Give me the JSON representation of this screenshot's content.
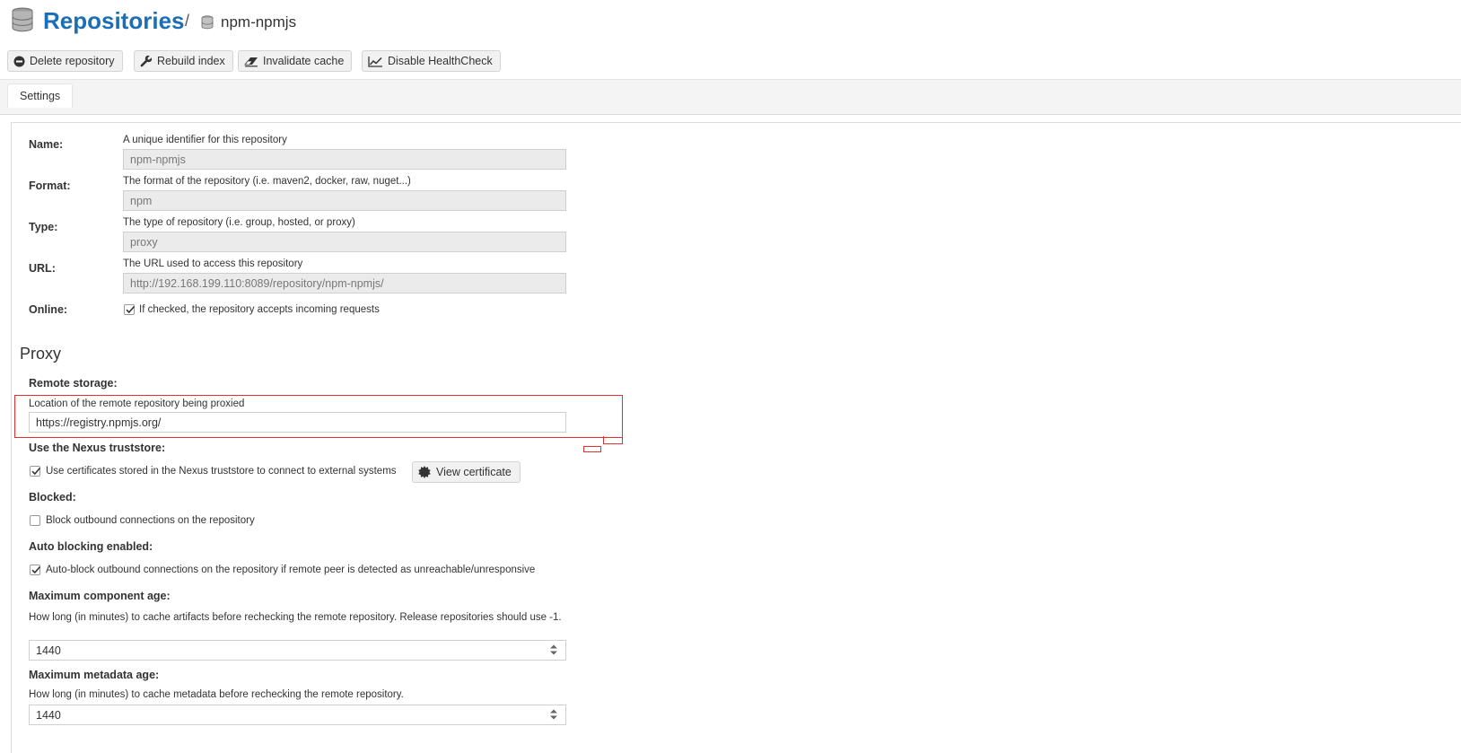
{
  "header": {
    "title": "Repositories",
    "separator": "/",
    "subtitle": "npm-npmjs"
  },
  "toolbar": {
    "delete_label": "Delete repository",
    "rebuild_label": "Rebuild index",
    "invalidate_label": "Invalidate cache",
    "healthcheck_label": "Disable HealthCheck"
  },
  "tabs": {
    "settings": "Settings"
  },
  "form": {
    "name": {
      "label": "Name:",
      "help": "A unique identifier for this repository",
      "value": "npm-npmjs"
    },
    "format": {
      "label": "Format:",
      "help": "The format of the repository (i.e. maven2, docker, raw, nuget...)",
      "value": "npm"
    },
    "type": {
      "label": "Type:",
      "help": "The type of repository (i.e. group, hosted, or proxy)",
      "value": "proxy"
    },
    "url": {
      "label": "URL:",
      "help": "The URL used to access this repository",
      "value": "http://192.168.199.110:8089/repository/npm-npmjs/"
    },
    "online": {
      "label": "Online:",
      "help": "If checked, the repository accepts incoming requests",
      "checked": true
    }
  },
  "proxy": {
    "section_title": "Proxy",
    "remote_storage": {
      "label": "Remote storage:",
      "help": "Location of the remote repository being proxied",
      "value": "https://registry.npmjs.org/"
    },
    "truststore": {
      "label": "Use the Nexus truststore:",
      "help": "Use certificates stored in the Nexus truststore to connect to external systems",
      "checked": true,
      "button": "View certificate"
    },
    "blocked": {
      "label": "Blocked:",
      "help": "Block outbound connections on the repository",
      "checked": false
    },
    "auto_blocking": {
      "label": "Auto blocking enabled:",
      "help": "Auto-block outbound connections on the repository if remote peer is detected as unreachable/unresponsive",
      "checked": true
    },
    "max_component_age": {
      "label": "Maximum component age:",
      "help": "How long (in minutes) to cache artifacts before rechecking the remote repository. Release repositories should use -1.",
      "value": "1440"
    },
    "max_metadata_age": {
      "label": "Maximum metadata age:",
      "help": "How long (in minutes) to cache metadata before rechecking the remote repository.",
      "value": "1440"
    }
  },
  "colors": {
    "accent": "#1c6fb6",
    "highlight": "#e03030"
  }
}
